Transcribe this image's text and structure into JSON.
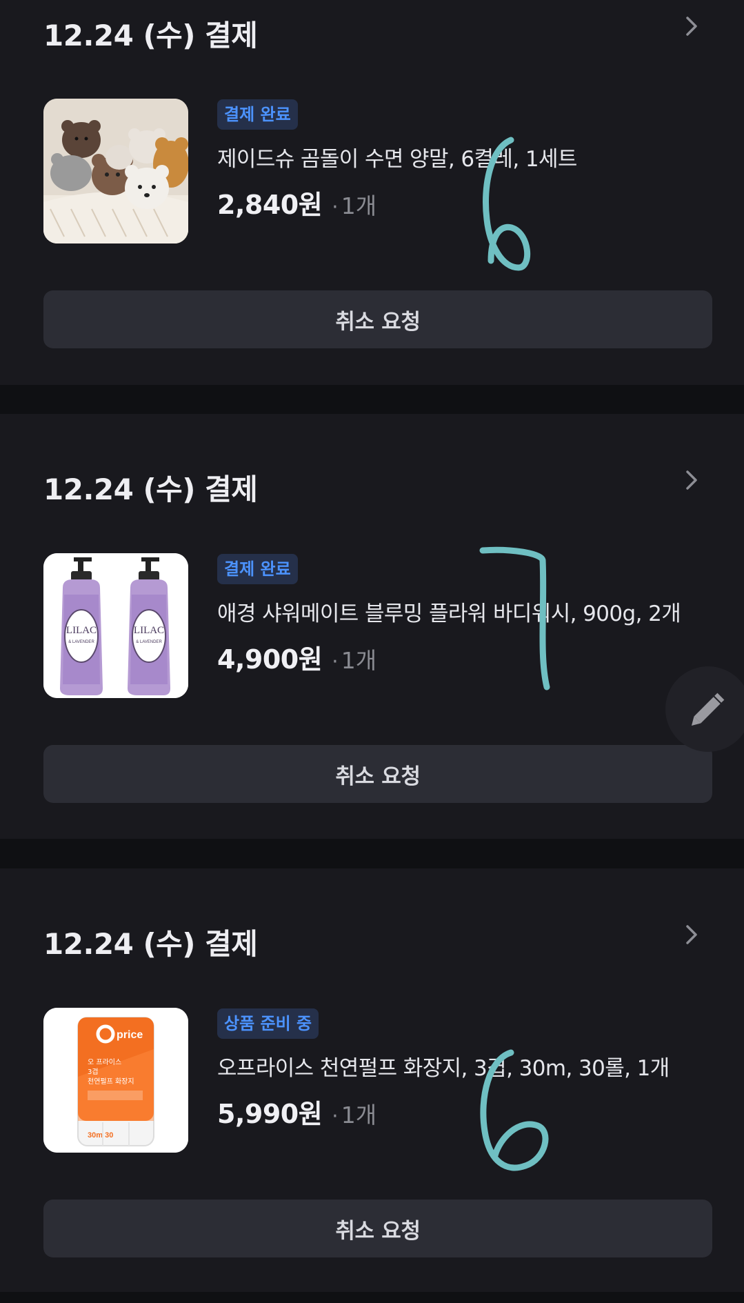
{
  "colors": {
    "background": "#0f1013",
    "card": "#19191e",
    "button": "#2c2d35",
    "badge_bg": "#25304a",
    "badge_text": "#4c93ff",
    "handwriting": "#6fbfc2"
  },
  "orders": [
    {
      "header": "12.24 (수) 결제",
      "status": "결제 완료",
      "product_name": "제이드슈 곰돌이 수면 양말, 6켤레, 1세트",
      "price": "2,840원",
      "dot": "·",
      "quantity": "1개",
      "action_label": "취소 요청"
    },
    {
      "header": "12.24 (수) 결제",
      "status": "결제 완료",
      "product_name": "애경 샤워메이트 블루밍 플라워 바디워시, 900g, 2개",
      "price": "4,900원",
      "dot": "·",
      "quantity": "1개",
      "action_label": "취소 요청"
    },
    {
      "header": "12.24 (수) 결제",
      "status": "상품 준비 중",
      "product_name": "오프라이스 천연펄프 화장지, 3겹, 30m, 30롤, 1개",
      "price": "5,990원",
      "dot": "·",
      "quantity": "1개",
      "action_label": "취소 요청"
    }
  ],
  "product_images": {
    "lilac_label_line1": "LILAC",
    "lilac_label_line2": "& LAVENDER",
    "price_brand": "price",
    "price_text_line1": "오 프라이스",
    "price_text_line2": "3겹",
    "price_text_line3": "천연펄프 화장지",
    "price_count": "30m 30"
  },
  "icons": {
    "chevron": "chevron-right-icon",
    "edit": "pencil-icon"
  },
  "annotations": [
    "6",
    "7",
    "6"
  ]
}
